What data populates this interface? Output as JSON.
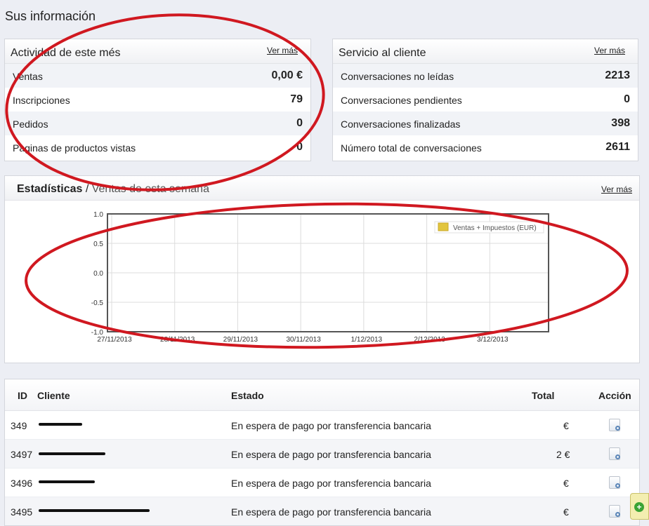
{
  "page": {
    "title": "Sus información"
  },
  "activity": {
    "title": "Actividad de este més",
    "ver_mas": "Ver más",
    "rows": [
      {
        "label": "Ventas",
        "value": "0,00 €"
      },
      {
        "label": "Inscripciones",
        "value": "79"
      },
      {
        "label": "Pedidos",
        "value": "0"
      },
      {
        "label": "Paginas de productos vistas",
        "value": "0"
      }
    ]
  },
  "service": {
    "title": "Servicio al cliente",
    "ver_mas": "Ver más",
    "rows": [
      {
        "label": "Conversaciones no leídas",
        "value": "2213"
      },
      {
        "label": "Conversaciones pendientes",
        "value": "0"
      },
      {
        "label": "Conversaciones finalizadas",
        "value": "398"
      },
      {
        "label": "Número total de conversaciones",
        "value": "2611"
      }
    ]
  },
  "stats": {
    "title": "Estadísticas",
    "separator": " / ",
    "subtitle": "Ventas de esta semana",
    "ver_mas": "Ver más"
  },
  "chart_data": {
    "type": "line",
    "categories": [
      "27/11/2013",
      "28/11/2013",
      "29/11/2013",
      "30/11/2013",
      "1/12/2013",
      "2/12/2013",
      "3/12/2013"
    ],
    "series": [
      {
        "name": "Ventas + Impuestos (EUR)",
        "values": [
          null,
          null,
          null,
          null,
          null,
          null,
          null
        ]
      }
    ],
    "yticks": [
      "1.0",
      "0.5",
      "0.0",
      "-0.5",
      "-1.0"
    ],
    "ylim": [
      -1.0,
      1.0
    ],
    "grid": true,
    "legend_position": "top-right",
    "legend_color": "#e2c53d"
  },
  "orders": {
    "headers": {
      "id": "ID",
      "client": "Cliente",
      "state": "Estado",
      "total": "Total",
      "action": "Acción"
    },
    "rows": [
      {
        "id": "349",
        "client": "",
        "state": "En espera de pago por transferencia bancaria",
        "total": "€"
      },
      {
        "id": "3497",
        "client": "",
        "state": "En espera de pago por transferencia bancaria",
        "total": "2 €"
      },
      {
        "id": "3496",
        "client": "",
        "state": "En espera de pago por transferencia bancaria",
        "total": "€"
      },
      {
        "id": "3495",
        "client": "",
        "state": "En espera de pago por transferencia bancaria",
        "total": "€"
      }
    ]
  },
  "colors": {
    "annotation": "#d01820",
    "action_icon": "search-document-icon",
    "corner_button": "green-plus-icon"
  }
}
